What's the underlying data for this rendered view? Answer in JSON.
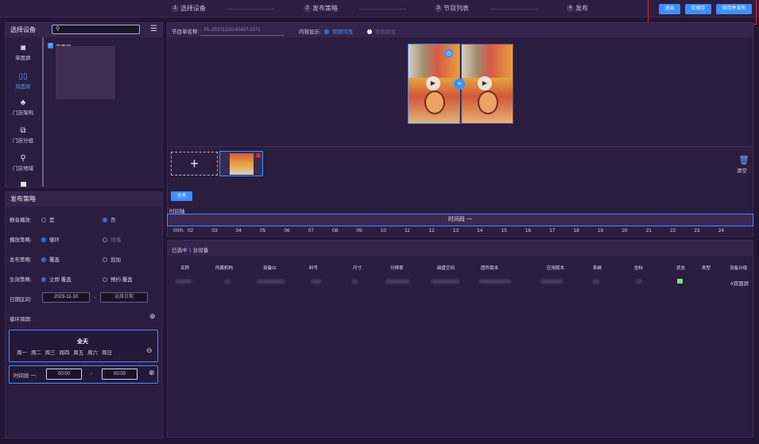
{
  "steps": [
    {
      "num": "1",
      "label": "选择设备"
    },
    {
      "num": "2",
      "label": "发布策略"
    },
    {
      "num": "3",
      "label": "节目列表"
    },
    {
      "num": "4",
      "label": "发布"
    }
  ],
  "actions": {
    "back": "退出",
    "save": "仅保存",
    "save_publish": "保存并发布"
  },
  "device_panel": {
    "title": "选择设备",
    "nav": [
      {
        "label": "单面屏",
        "icon": "single-screen-icon"
      },
      {
        "label": "双面屏",
        "icon": "dual-screen-icon"
      },
      {
        "label": "门店架构",
        "icon": "org-tree-icon"
      },
      {
        "label": "门店分组",
        "icon": "group-icon"
      },
      {
        "label": "门店地域",
        "icon": "location-icon"
      }
    ],
    "tree_item": "双面屏"
  },
  "strategy": {
    "title": "发布策略",
    "silent_label": "静音播放:",
    "silent_yes": "是",
    "silent_no": "否",
    "play_label": "播放策略:",
    "play_loop": "循环",
    "play_order": "插播",
    "publish_label": "发布策略:",
    "publish_cover": "覆盖",
    "publish_add": "追加",
    "effect_label": "生效策略:",
    "effect_now": "立即 覆盖",
    "effect_schedule": "预约 覆盖",
    "date_label": "日期区间:",
    "date_start": "2023-11-10",
    "date_sep": "-",
    "date_end_placeholder": "选择日期",
    "cycle_label": "循环周期:",
    "cycle_all": "全天",
    "weekdays": [
      "周一",
      "周二",
      "周三",
      "周四",
      "周五",
      "周六",
      "周日"
    ],
    "period_label": "时间段 一:",
    "period_start": "00:00",
    "period_sep": "-",
    "period_end": "00:00"
  },
  "program": {
    "name_label": "节目单名称:",
    "name_value": "PL-20231110140437-1371",
    "display_label": "内容显示:",
    "display_dual": "双屏同显",
    "display_diff": "双屏异显",
    "clear_label": "清空",
    "all_day_btn": "全天",
    "timeline_label": "时间轴",
    "timeline_segment": "时间段 一",
    "hours": [
      "00/h",
      "02",
      "03",
      "04",
      "05",
      "06",
      "07",
      "08",
      "09",
      "10",
      "11",
      "12",
      "13",
      "14",
      "15",
      "16",
      "17",
      "18",
      "19",
      "20",
      "21",
      "22",
      "23",
      "24"
    ]
  },
  "devices": {
    "selected_prefix": "已选中",
    "selected_count": "1",
    "selected_suffix": "台设备",
    "columns": [
      "名称",
      "所属机构",
      "设备ID",
      "料号",
      "尺寸",
      "分辨率",
      "磁盘空间",
      "固件版本",
      "应用版本",
      "系统",
      "坐标",
      "状态",
      "类型",
      "设备分组"
    ],
    "row_group": "#双面屏"
  },
  "colors": {
    "accent": "#3d8fff",
    "bg": "#231634",
    "panel": "#2b1d40",
    "highlight": "#e8202a"
  }
}
